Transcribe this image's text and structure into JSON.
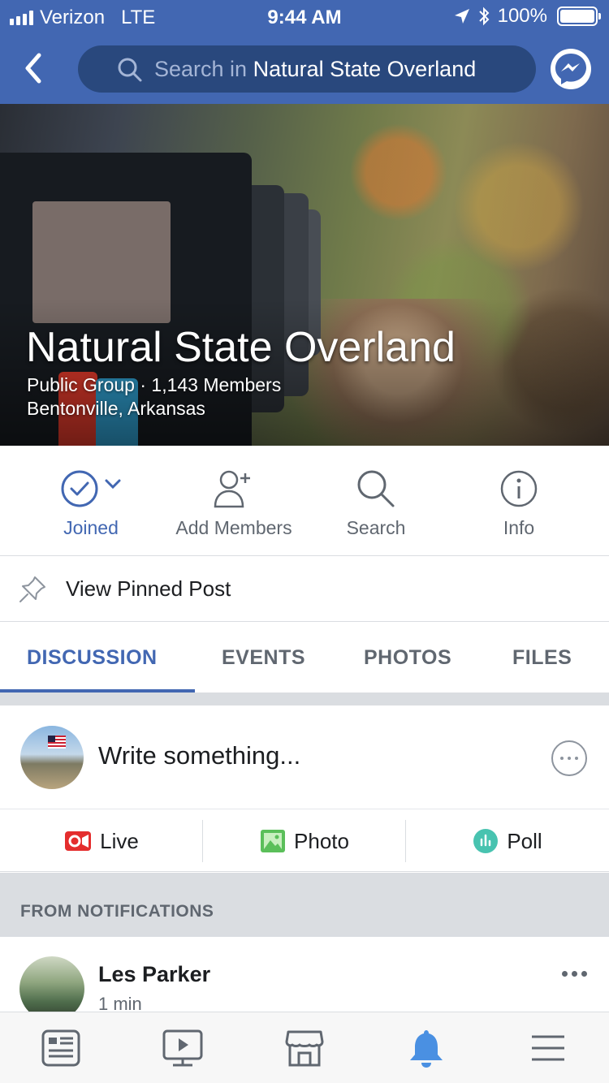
{
  "status_bar": {
    "carrier": "Verizon",
    "network": "LTE",
    "time": "9:44 AM",
    "battery": "100%",
    "battery_level": 1.0
  },
  "nav": {
    "search_prefix": "Search in",
    "search_group": "Natural State Overland"
  },
  "group": {
    "name": "Natural State Overland",
    "meta_line1": "Public Group · 1,143 Members",
    "meta_line2": "Bentonville, Arkansas"
  },
  "actions": {
    "joined": "Joined",
    "add_members": "Add Members",
    "search": "Search",
    "info": "Info"
  },
  "pinned": {
    "label": "View Pinned Post"
  },
  "tabs": [
    "DISCUSSION",
    "EVENTS",
    "PHOTOS",
    "FILES"
  ],
  "active_tab": "DISCUSSION",
  "composer": {
    "placeholder": "Write something..."
  },
  "post_types": {
    "live": "Live",
    "photo": "Photo",
    "poll": "Poll"
  },
  "section_header": "FROM NOTIFICATIONS",
  "post": {
    "author": "Les Parker",
    "time": "1 min"
  },
  "colors": {
    "brand": "#4267b2",
    "live": "#e42d2d",
    "photo": "#5bbf5a",
    "poll": "#48c3b0",
    "bell_active": "#4a90e2"
  },
  "bottom_tabs": [
    "news-feed-icon",
    "watch-icon",
    "marketplace-icon",
    "notifications-icon",
    "menu-icon"
  ]
}
